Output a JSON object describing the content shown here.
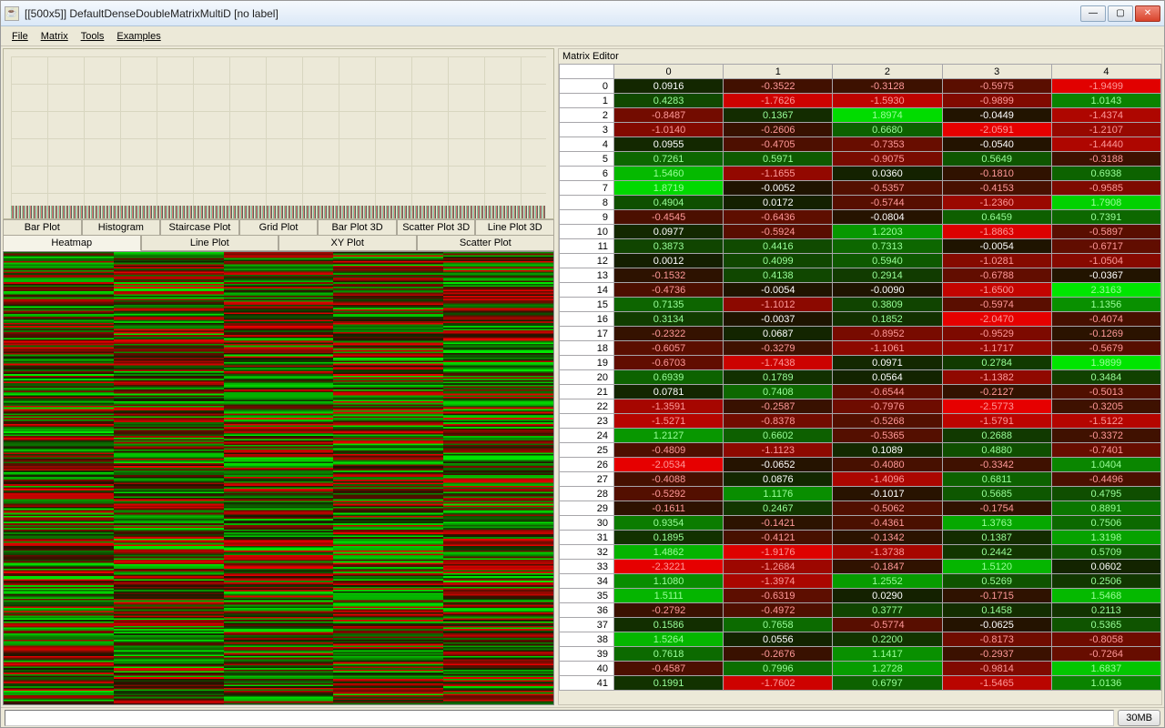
{
  "window": {
    "title": "[[500x5]] DefaultDenseDoubleMatrixMultiD [no label]"
  },
  "menubar": [
    "File",
    "Matrix",
    "Tools",
    "Examples"
  ],
  "tabs_row1": [
    "Bar Plot",
    "Histogram",
    "Staircase Plot",
    "Grid Plot",
    "Bar Plot 3D",
    "Scatter Plot 3D",
    "Line Plot 3D"
  ],
  "tabs_row2": [
    "Heatmap",
    "Line Plot",
    "XY Plot",
    "Scatter Plot"
  ],
  "active_tab": "Heatmap",
  "editor_title": "Matrix Editor",
  "col_headers": [
    "0",
    "1",
    "2",
    "3",
    "4"
  ],
  "status_mem": "30MB",
  "chart_data": {
    "type": "heatmap",
    "rows_visible": 42,
    "cols": 5,
    "row_headers": [
      "0",
      "1",
      "2",
      "3",
      "4",
      "5",
      "6",
      "7",
      "8",
      "9",
      "10",
      "11",
      "12",
      "13",
      "14",
      "15",
      "16",
      "17",
      "18",
      "19",
      "20",
      "21",
      "22",
      "23",
      "24",
      "25",
      "26",
      "27",
      "28",
      "29",
      "30",
      "31",
      "32",
      "33",
      "34",
      "35",
      "36",
      "37",
      "38",
      "39",
      "40",
      "41"
    ],
    "values": [
      [
        0.0916,
        -0.3522,
        -0.3128,
        -0.5975,
        -1.9499
      ],
      [
        0.4283,
        -1.7626,
        -1.593,
        -0.9899,
        1.0143
      ],
      [
        -0.8487,
        0.1367,
        1.8974,
        -0.0449,
        -1.4374
      ],
      [
        -1.014,
        -0.2606,
        0.668,
        -2.0591,
        -1.2107
      ],
      [
        0.0955,
        -0.4705,
        -0.7353,
        -0.054,
        -1.444
      ],
      [
        0.7261,
        0.5971,
        -0.9075,
        0.5649,
        -0.3188
      ],
      [
        1.546,
        -1.1655,
        0.036,
        -0.181,
        0.6938
      ],
      [
        1.8719,
        -0.0052,
        -0.5357,
        -0.4153,
        -0.9585
      ],
      [
        0.4904,
        0.0172,
        -0.5744,
        -1.236,
        1.7908
      ],
      [
        -0.4545,
        -0.6436,
        -0.0804,
        0.6459,
        0.7391
      ],
      [
        0.0977,
        -0.5924,
        1.2203,
        -1.8863,
        -0.5897
      ],
      [
        0.3873,
        0.4416,
        0.7313,
        -0.0054,
        -0.6717
      ],
      [
        0.0012,
        0.4099,
        0.594,
        -1.0281,
        -1.0504
      ],
      [
        -0.1532,
        0.4138,
        0.2914,
        -0.6788,
        -0.0367
      ],
      [
        -0.4736,
        -0.0054,
        -0.009,
        -1.65,
        2.3163
      ],
      [
        0.7135,
        -1.1012,
        0.3809,
        -0.5974,
        1.1356
      ],
      [
        0.3134,
        -0.0037,
        0.1852,
        -2.047,
        -0.4074
      ],
      [
        -0.2322,
        0.0687,
        -0.8952,
        -0.9529,
        -0.1269
      ],
      [
        -0.6057,
        -0.3279,
        -1.1061,
        -1.1717,
        -0.5679
      ],
      [
        -0.6703,
        -1.7438,
        0.0971,
        0.2784,
        1.9899
      ],
      [
        0.6939,
        0.1789,
        0.0564,
        -1.1382,
        0.3484
      ],
      [
        0.0781,
        0.7408,
        -0.6544,
        -0.2127,
        -0.5013
      ],
      [
        -1.3591,
        -0.2587,
        -0.7976,
        -2.5773,
        -0.3205
      ],
      [
        -1.5271,
        -0.8378,
        -0.5268,
        -1.5791,
        -1.5122
      ],
      [
        1.2127,
        0.6602,
        -0.5365,
        0.2688,
        -0.3372
      ],
      [
        -0.4809,
        -1.1123,
        0.1089,
        0.488,
        -0.7401
      ],
      [
        -2.0534,
        -0.0652,
        -0.408,
        -0.3342,
        1.0404
      ],
      [
        -0.4088,
        0.0876,
        -1.4096,
        0.6811,
        -0.4496
      ],
      [
        -0.5292,
        1.1176,
        -0.1017,
        0.5685,
        0.4795
      ],
      [
        -0.1611,
        0.2467,
        -0.5062,
        -0.1754,
        0.8891
      ],
      [
        0.9354,
        -0.1421,
        -0.4361,
        1.3763,
        0.7506
      ],
      [
        0.1895,
        -0.4121,
        -0.1342,
        0.1387,
        1.3198
      ],
      [
        1.4862,
        -1.9176,
        -1.3738,
        0.2442,
        0.5709
      ],
      [
        -2.3221,
        -1.2684,
        -0.1847,
        1.512,
        0.0602
      ],
      [
        1.108,
        -1.3974,
        1.2552,
        0.5269,
        0.2506
      ],
      [
        1.5111,
        -0.6319,
        0.029,
        -0.1715,
        1.5468
      ],
      [
        -0.2792,
        -0.4972,
        0.3777,
        0.1458,
        0.2113
      ],
      [
        0.1586,
        0.7658,
        -0.5774,
        -0.0625,
        0.5365
      ],
      [
        1.5264,
        0.0556,
        0.22,
        -0.8173,
        -0.8058
      ],
      [
        0.7618,
        -0.2676,
        1.1417,
        -0.2937,
        -0.7264
      ],
      [
        -0.4587,
        0.7996,
        1.2728,
        -0.9814,
        1.6837
      ],
      [
        0.1991,
        -1.7602,
        0.6797,
        -1.5465,
        1.0136
      ]
    ]
  }
}
